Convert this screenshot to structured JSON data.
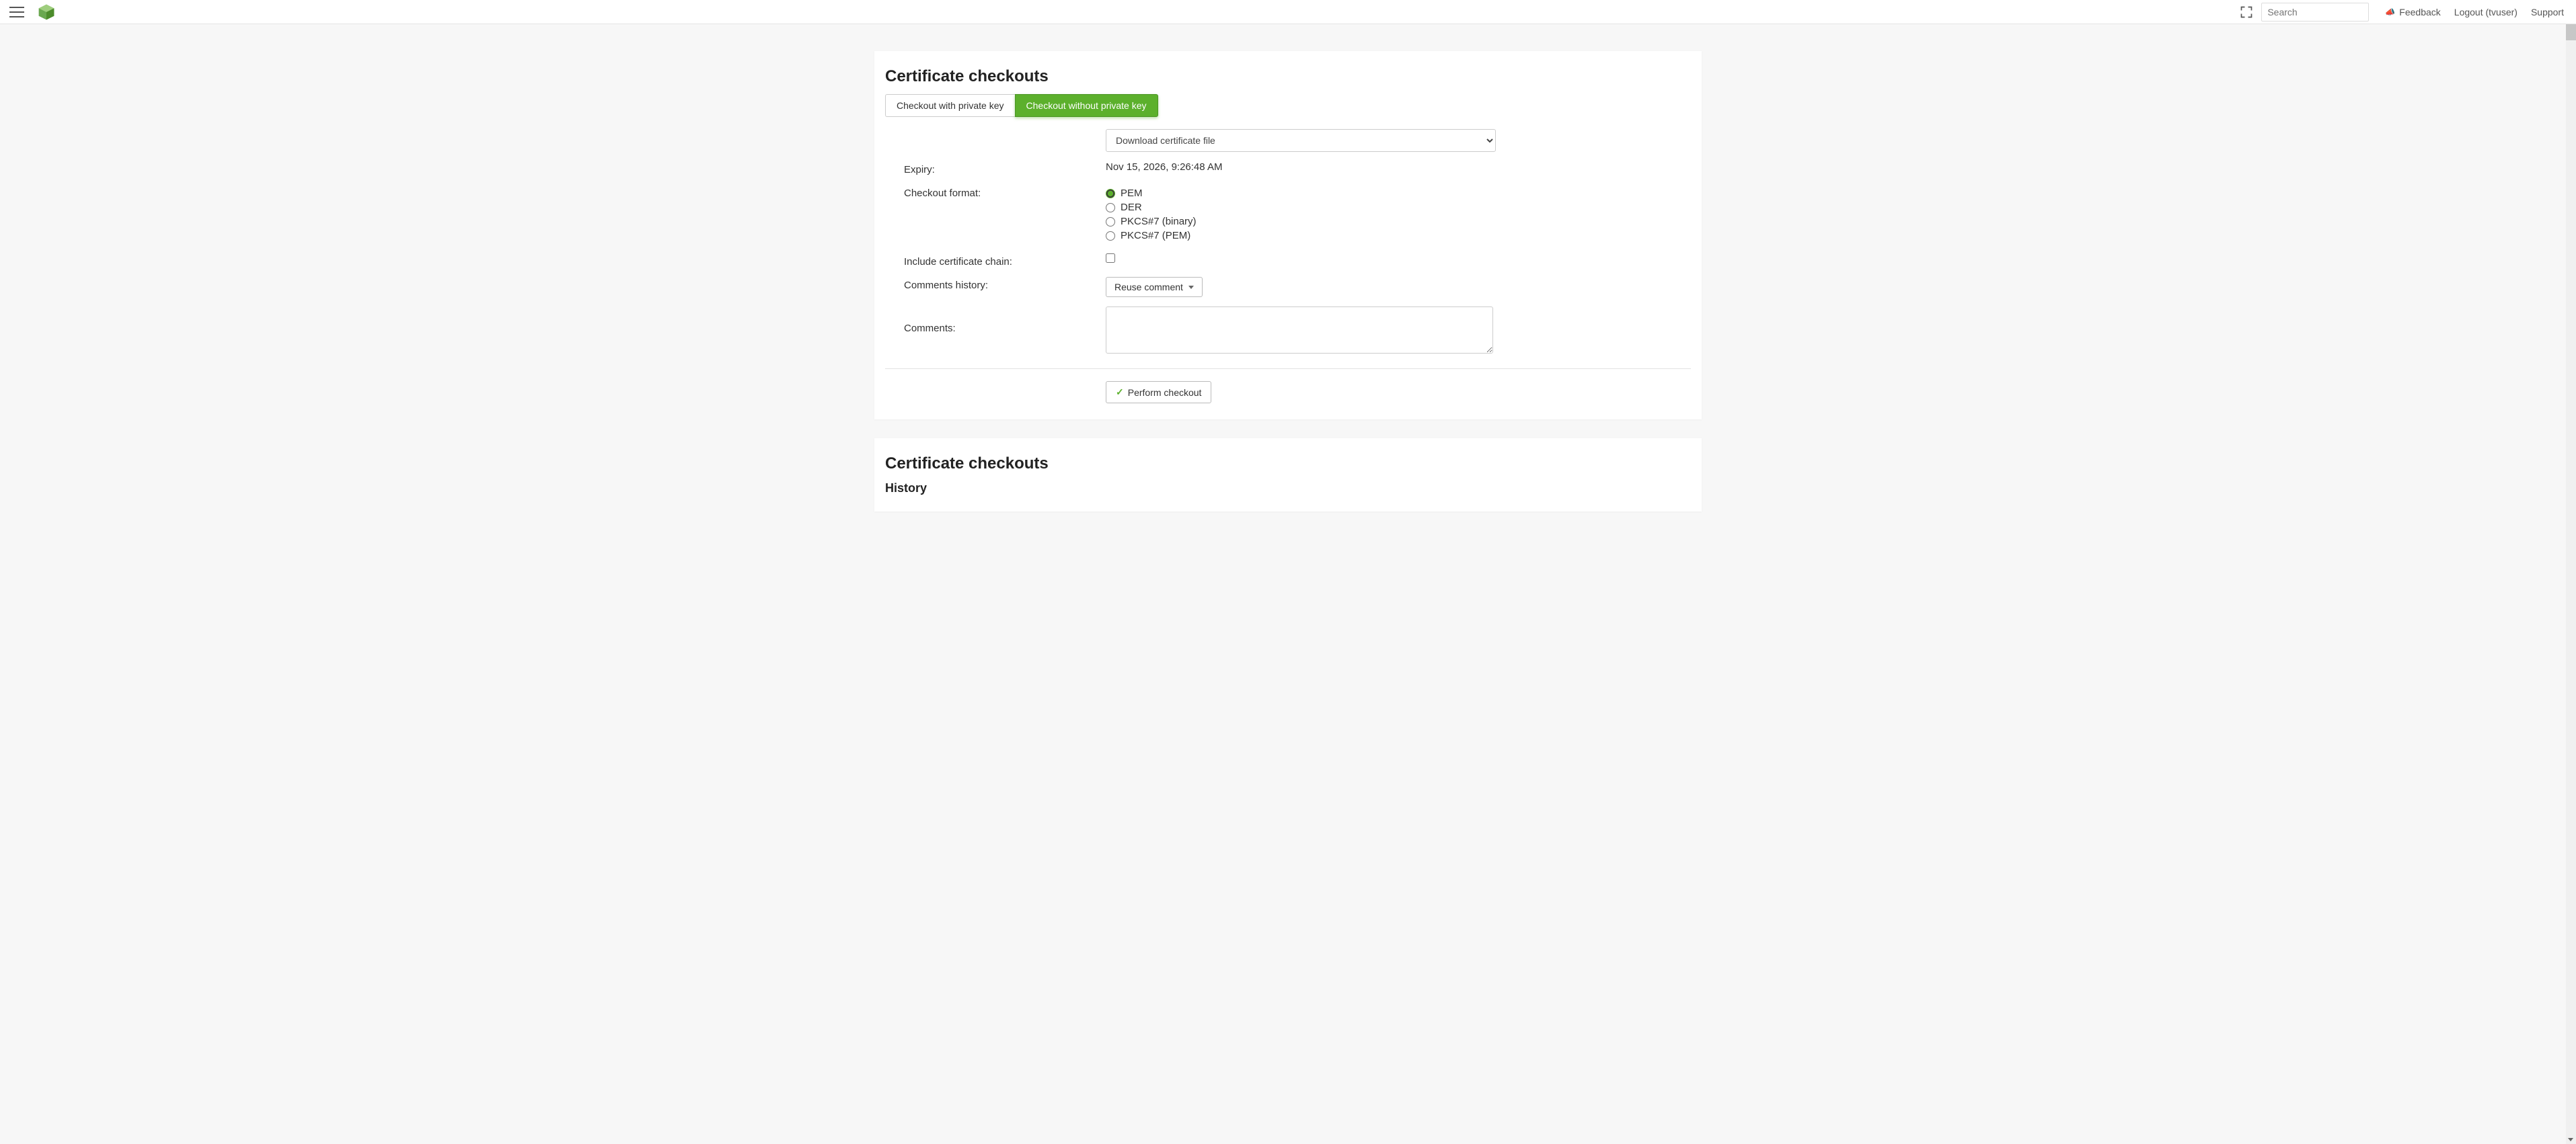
{
  "header": {
    "search_placeholder": "Search",
    "feedback": "Feedback",
    "logout": "Logout (tvuser)",
    "support": "Support"
  },
  "checkout_card": {
    "title": "Certificate checkouts",
    "tabs": {
      "with_key": "Checkout with private key",
      "without_key": "Checkout without private key"
    },
    "download_select": "Download certificate file",
    "labels": {
      "expiry": "Expiry:",
      "format": "Checkout format:",
      "include_chain": "Include certificate chain:",
      "comments_history": "Comments history:",
      "comments": "Comments:"
    },
    "expiry_value": "Nov 15, 2026, 9:26:48 AM",
    "formats": {
      "pem": "PEM",
      "der": "DER",
      "pkcs7_bin": "PKCS#7 (binary)",
      "pkcs7_pem": "PKCS#7 (PEM)"
    },
    "reuse_comment": "Reuse comment",
    "perform": "Perform checkout"
  },
  "history_card": {
    "title": "Certificate checkouts",
    "subtitle": "History"
  }
}
